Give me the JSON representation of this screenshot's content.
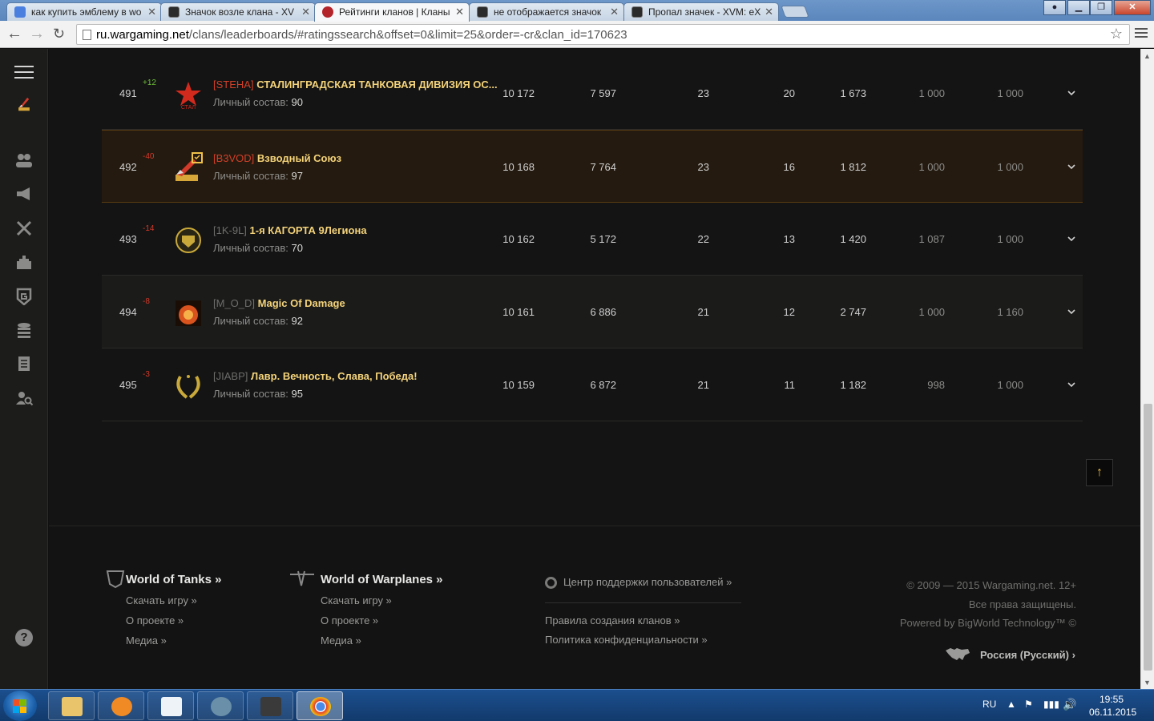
{
  "browser": {
    "tabs": [
      {
        "title": "как купить эмблему в wo",
        "icon": "google-icon",
        "color": "#4a7fe0"
      },
      {
        "title": "Значок возле клана - XV",
        "icon": "xvm-icon",
        "color": "#2b2b2b"
      },
      {
        "title": "Рейтинги кланов | Кланы",
        "icon": "wargaming-icon",
        "color": "#b3232a",
        "active": true
      },
      {
        "title": "не отображается значок",
        "icon": "xvm-icon",
        "color": "#2b2b2b"
      },
      {
        "title": "Пропал значек - XVM: eX",
        "icon": "xvm-icon",
        "color": "#2b2b2b"
      }
    ],
    "url_domain": "ru.wargaming.net",
    "url_path": "/clans/leaderboards/#ratingssearch&offset=0&limit=25&order=-cr&clan_id=170623"
  },
  "sidebar": {
    "items": [
      "clan-emblem",
      "members-icon",
      "megaphone-icon",
      "crossed-swords-icon",
      "fortress-icon",
      "shield-g-icon",
      "coins-icon",
      "document-icon",
      "search-clan-icon"
    ],
    "help": "?"
  },
  "table": {
    "members_label": "Личный состав:",
    "rows": [
      {
        "rank": "491",
        "delta": "+12",
        "dir": "up",
        "tag": "[STEHA]",
        "tag_style": "red",
        "name": "СТАЛИНГРАДСКАЯ ТАНКОВАЯ ДИВИЗИЯ ОС...",
        "members": "90",
        "emblem": "red-star",
        "c1": "10 172",
        "c2": "7 597",
        "c3": "23",
        "c4": "20",
        "c5": "1 673",
        "c6": "1 000",
        "c7": "1 000"
      },
      {
        "rank": "492",
        "delta": "-40",
        "dir": "down",
        "tag": "[B3VOD]",
        "tag_style": "red",
        "name": "Взводный Союз",
        "members": "97",
        "emblem": "brush",
        "c1": "10 168",
        "c2": "7 764",
        "c3": "23",
        "c4": "16",
        "c5": "1 812",
        "c6": "1 000",
        "c7": "1 000",
        "mine": true
      },
      {
        "rank": "493",
        "delta": "-14",
        "dir": "down",
        "tag": "[1K-9L]",
        "tag_style": "grey",
        "name": "1-я КАГОРТА 9Легиона",
        "members": "70",
        "emblem": "golden-shield",
        "c1": "10 162",
        "c2": "5 172",
        "c3": "22",
        "c4": "13",
        "c5": "1 420",
        "c6": "1 087",
        "c7": "1 000"
      },
      {
        "rank": "494",
        "delta": "-8",
        "dir": "down",
        "tag": "[M_O_D]",
        "tag_style": "grey",
        "name": "Magic Of Damage",
        "members": "92",
        "emblem": "fire-orb",
        "c1": "10 161",
        "c2": "6 886",
        "c3": "21",
        "c4": "12",
        "c5": "2 747",
        "c6": "1 000",
        "c7": "1 160"
      },
      {
        "rank": "495",
        "delta": "-3",
        "dir": "down",
        "tag": "[JIABP]",
        "tag_style": "grey",
        "name": "Лавр. Вечность, Слава, Победа!",
        "members": "95",
        "emblem": "laurel",
        "c1": "10 159",
        "c2": "6 872",
        "c3": "21",
        "c4": "11",
        "c5": "1 182",
        "c6": "998",
        "c7": "1 000"
      }
    ]
  },
  "scroll_top_label": "↑",
  "footer": {
    "wot": {
      "title": "World of Tanks »",
      "links": [
        "Скачать игру »",
        "О проекте »",
        "Медиа »"
      ]
    },
    "wowp": {
      "title": "World of Warplanes »",
      "links": [
        "Скачать игру »",
        "О проекте »",
        "Медиа »"
      ]
    },
    "support": "Центр поддержки пользователей »",
    "rules": "Правила создания кланов »",
    "privacy": "Политика конфиденциальности »",
    "copyright": "© 2009 — 2015 Wargaming.net. 12+",
    "rights": "Все права защищены.",
    "powered": "Powered by BigWorld Technology™ ©",
    "language": "Россия (Русский)"
  },
  "taskbar": {
    "lang": "RU",
    "time": "19:55",
    "date": "06.11.2015"
  }
}
